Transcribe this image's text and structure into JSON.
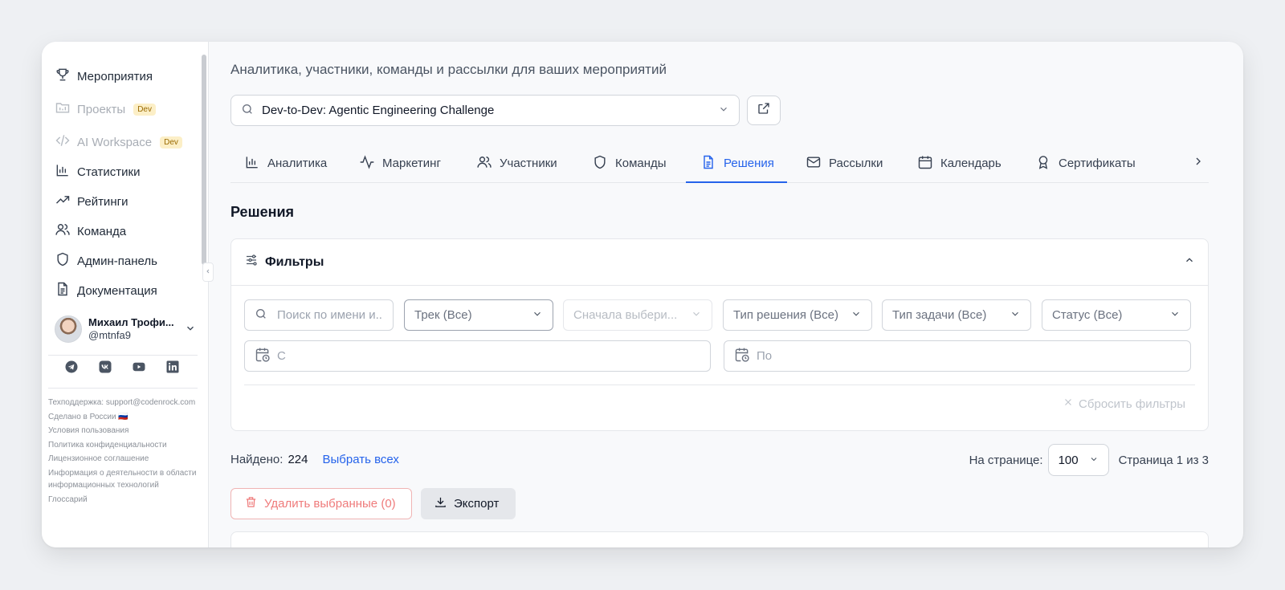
{
  "sidebar": {
    "items": [
      {
        "label": "Мероприятия",
        "icon": "trophy-icon"
      },
      {
        "label": "Проекты",
        "icon": "folder-icon",
        "badge": "Dev"
      },
      {
        "label": "AI Workspace",
        "icon": "code-icon",
        "badge": "Dev"
      },
      {
        "label": "Статистики",
        "icon": "bar-chart-icon"
      },
      {
        "label": "Рейтинги",
        "icon": "trending-up-icon"
      },
      {
        "label": "Команда",
        "icon": "users-icon"
      },
      {
        "label": "Админ-панель",
        "icon": "shield-icon"
      },
      {
        "label": "Документация",
        "icon": "document-icon"
      }
    ],
    "user": {
      "name": "Михаил Трофи...",
      "handle": "@mtnfa9"
    },
    "socials": [
      "telegram-icon",
      "vk-icon",
      "youtube-icon",
      "linkedin-icon"
    ],
    "footer": {
      "support": "Техподдержка: support@codenrock.com",
      "made_in": "Сделано в России 🇷🇺",
      "terms": "Условия пользования",
      "privacy": "Политика конфиденциальности",
      "license": "Лицензионное соглашение",
      "it_info": "Информация о деятельности в области информационных технологий",
      "glossary": "Глоссарий"
    }
  },
  "header": {
    "subtitle": "Аналитика, участники, команды и рассылки для ваших мероприятий",
    "event": "Dev-to-Dev: Agentic Engineering Challenge"
  },
  "tabs": [
    {
      "label": "Аналитика",
      "icon": "bar-chart-icon"
    },
    {
      "label": "Маркетинг",
      "icon": "activity-icon"
    },
    {
      "label": "Участники",
      "icon": "users-icon"
    },
    {
      "label": "Команды",
      "icon": "shield-icon"
    },
    {
      "label": "Решения",
      "icon": "document-icon",
      "active": true
    },
    {
      "label": "Рассылки",
      "icon": "mail-icon"
    },
    {
      "label": "Календарь",
      "icon": "calendar-icon"
    },
    {
      "label": "Сертификаты",
      "icon": "award-icon"
    }
  ],
  "section_title": "Решения",
  "filters": {
    "title": "Фильтры",
    "search_placeholder": "Поиск по имени и...",
    "track": "Трек (Все)",
    "stage": "Сначала выбери...",
    "solution_type": "Тип решения (Все)",
    "task_type": "Тип задачи (Все)",
    "status": "Статус (Все)",
    "date_from": "С",
    "date_to": "По",
    "reset": "Сбросить фильтры"
  },
  "results": {
    "found_label": "Найдено:",
    "found_count": "224",
    "select_all": "Выбрать всех",
    "per_page_label": "На странице:",
    "per_page": "100",
    "page_info": "Страница 1 из 3"
  },
  "actions": {
    "delete": "Удалить выбранные (0)",
    "export": "Экспорт"
  },
  "colors": {
    "accent": "#2563eb",
    "danger": "#ef7b7b",
    "dev_badge": "#fcefc7"
  }
}
